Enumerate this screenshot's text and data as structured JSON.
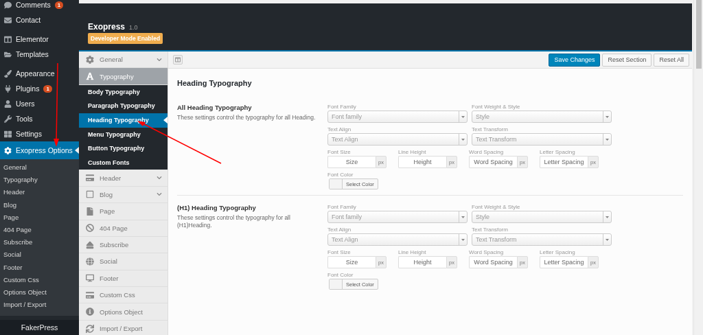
{
  "wp_menu": {
    "groups": [
      [
        {
          "label": "Comments",
          "badge": "1",
          "selected": false
        },
        {
          "label": "Contact",
          "selected": false
        }
      ],
      [
        {
          "label": "Elementor",
          "selected": false
        },
        {
          "label": "Templates",
          "selected": false
        }
      ],
      [
        {
          "label": "Appearance",
          "selected": false
        },
        {
          "label": "Plugins",
          "badge": "1",
          "selected": false
        },
        {
          "label": "Users",
          "selected": false
        },
        {
          "label": "Tools",
          "selected": false
        },
        {
          "label": "Settings",
          "selected": false
        },
        {
          "label": "Exopress Options",
          "selected": true,
          "submenu": [
            "General",
            "Typography",
            "Header",
            "Blog",
            "Page",
            "404 Page",
            "Subscribe",
            "Social",
            "Footer",
            "Custom Css",
            "Options Object",
            "Import / Export"
          ]
        }
      ],
      [
        {
          "label": "FakerPress",
          "selected": false
        }
      ]
    ]
  },
  "panel": {
    "title": "Exopress",
    "version": "1.0",
    "badge": "Developer Mode Enabled",
    "nav": [
      {
        "label": "General",
        "collapsible": true,
        "selected": false
      },
      {
        "label": "Typography",
        "collapsible": false,
        "selected": true,
        "children": [
          {
            "label": "Body Typography",
            "selected": false
          },
          {
            "label": "Paragraph Typography",
            "selected": false
          },
          {
            "label": "Heading Typography",
            "selected": true
          },
          {
            "label": "Menu Typography",
            "selected": false
          },
          {
            "label": "Button Typography",
            "selected": false
          },
          {
            "label": "Custom Fonts",
            "selected": false
          }
        ]
      },
      {
        "label": "Header",
        "collapsible": true,
        "selected": false
      },
      {
        "label": "Blog",
        "collapsible": true,
        "selected": false
      },
      {
        "label": "Page",
        "collapsible": false,
        "selected": false
      },
      {
        "label": "404 Page",
        "collapsible": false,
        "selected": false
      },
      {
        "label": "Subscribe",
        "collapsible": false,
        "selected": false
      },
      {
        "label": "Social",
        "collapsible": false,
        "selected": false
      },
      {
        "label": "Footer",
        "collapsible": false,
        "selected": false
      },
      {
        "label": "Custom Css",
        "collapsible": false,
        "selected": false
      },
      {
        "label": "Options Object",
        "collapsible": false,
        "selected": false
      },
      {
        "label": "Import / Export",
        "collapsible": false,
        "selected": false
      }
    ],
    "buttons": [
      {
        "label": "Save Changes",
        "kind": "primary"
      },
      {
        "label": "Reset Section",
        "kind": "secondary"
      },
      {
        "label": "Reset All",
        "kind": "secondary"
      }
    ],
    "page_title": "Heading Typography",
    "sections": [
      {
        "title": "All Heading Typography",
        "description": "These settings control the typography for all Heading.",
        "rows": [
          [
            {
              "kind": "select",
              "label": "Font Family",
              "placeholder": "Font family"
            },
            {
              "kind": "select",
              "label": "Font Weight & Style",
              "placeholder": "Style"
            }
          ],
          [
            {
              "kind": "select",
              "label": "Text Align",
              "placeholder": "Text Align"
            },
            {
              "kind": "select",
              "label": "Text Transform",
              "placeholder": "Text Transform"
            }
          ],
          [
            {
              "kind": "unit",
              "label": "Font Size",
              "placeholder": "Size",
              "unit": "px"
            },
            {
              "kind": "unit",
              "label": "Line Height",
              "placeholder": "Height",
              "unit": "px"
            },
            {
              "kind": "unit",
              "label": "Word Spacing",
              "placeholder": "Word Spacing",
              "unit": "px"
            },
            {
              "kind": "unit",
              "label": "Letter Spacing",
              "placeholder": "Letter Spacing",
              "unit": "px"
            }
          ],
          [
            {
              "kind": "color",
              "label": "Font Color",
              "button": "Select Color"
            }
          ]
        ]
      },
      {
        "title": "(H1) Heading Typography",
        "description": "These settings control the typography for all (H1)Heading.",
        "rows": [
          [
            {
              "kind": "select",
              "label": "Font Family",
              "placeholder": "Font family"
            },
            {
              "kind": "select",
              "label": "Font Weight & Style",
              "placeholder": "Style"
            }
          ],
          [
            {
              "kind": "select",
              "label": "Text Align",
              "placeholder": "Text Align"
            },
            {
              "kind": "select",
              "label": "Text Transform",
              "placeholder": "Text Transform"
            }
          ],
          [
            {
              "kind": "unit",
              "label": "Font Size",
              "placeholder": "Size",
              "unit": "px"
            },
            {
              "kind": "unit",
              "label": "Line Height",
              "placeholder": "Height",
              "unit": "px"
            },
            {
              "kind": "unit",
              "label": "Word Spacing",
              "placeholder": "Word Spacing",
              "unit": "px"
            },
            {
              "kind": "unit",
              "label": "Letter Spacing",
              "placeholder": "Letter Spacing",
              "unit": "px"
            }
          ],
          [
            {
              "kind": "color",
              "label": "Font Color",
              "button": "Select Color"
            }
          ]
        ]
      }
    ]
  }
}
